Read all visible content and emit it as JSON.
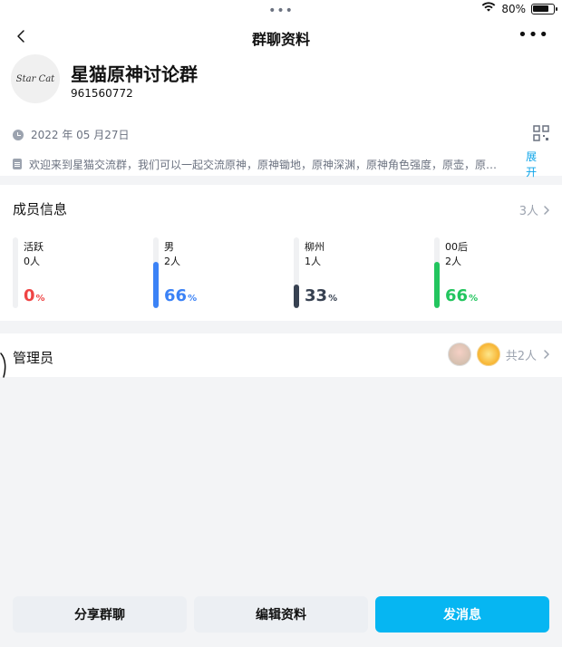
{
  "status": {
    "battery": "80%",
    "battery_level": 0.8
  },
  "nav": {
    "title": "群聊资料"
  },
  "profile": {
    "avatar_text": "Star Cat",
    "name": "星猫原神讨论群",
    "id": "961560772",
    "date": "2022 年 05 月27日",
    "intro": "欢迎来到星猫交流群，我们可以一起交流原神，原神锄地，原神深渊，原神角色强度，原壶，原…",
    "expand": "展开"
  },
  "members": {
    "title": "成员信息",
    "count": "3人",
    "stats": [
      {
        "label": "活跃",
        "count": "0人",
        "pct": "0",
        "color": "#ef4444",
        "fill": 0.0
      },
      {
        "label": "男",
        "count": "2人",
        "pct": "66",
        "color": "#3b82f6",
        "fill": 0.66
      },
      {
        "label": "柳州",
        "count": "1人",
        "pct": "33",
        "color": "#374151",
        "fill": 0.33
      },
      {
        "label": "00后",
        "count": "2人",
        "pct": "66",
        "color": "#22c55e",
        "fill": 0.66
      }
    ]
  },
  "admins": {
    "title": "管理员",
    "count": "共2人"
  },
  "buttons": {
    "share": "分享群聊",
    "edit": "编辑资料",
    "send": "发消息"
  }
}
